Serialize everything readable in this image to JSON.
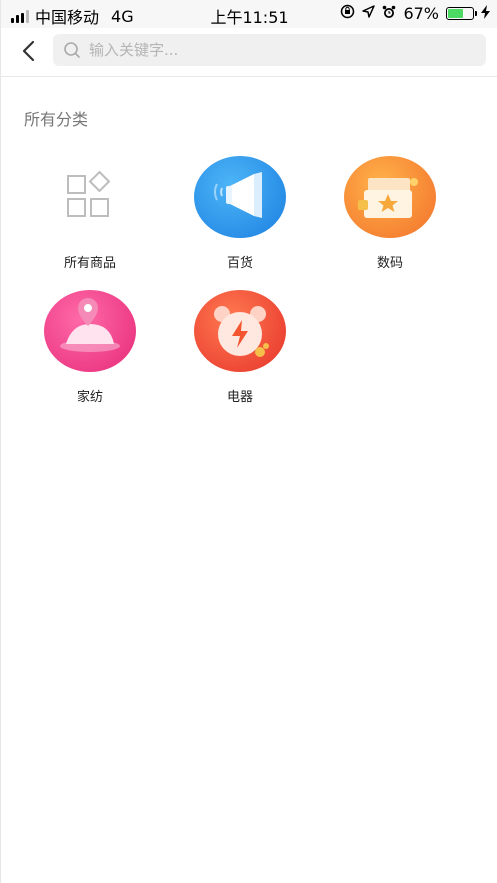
{
  "status_bar": {
    "carrier": "中国移动",
    "network": "4G",
    "time": "上午11:51",
    "battery_percent": "67%",
    "battery_level": 0.67
  },
  "search": {
    "placeholder": "输入关键字..."
  },
  "section": {
    "title": "所有分类"
  },
  "categories": [
    {
      "label": "所有商品",
      "icon": "grid-icon"
    },
    {
      "label": "百货",
      "icon": "megaphone-icon",
      "color": "#2a8fe6"
    },
    {
      "label": "数码",
      "icon": "ticket-star-icon",
      "color": "#f58a2a"
    },
    {
      "label": "家纺",
      "icon": "location-pin-icon",
      "color": "#ec3f87"
    },
    {
      "label": "电器",
      "icon": "alarm-clock-icon",
      "color": "#f04b2e"
    }
  ]
}
